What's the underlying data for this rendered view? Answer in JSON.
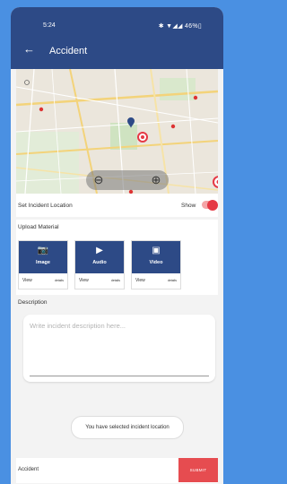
{
  "status": {
    "time": "5:24",
    "icons_text": "✱ ▼◢◢ 46%▯",
    "battery": "46%"
  },
  "appbar": {
    "back_icon": "←",
    "title": "Accident"
  },
  "map": {
    "zoom_out_symbol": "⊖",
    "zoom_in_symbol": "⊕"
  },
  "location": {
    "label": "Set Incident Location",
    "show_label": "Show",
    "show_enabled": true
  },
  "upload": {
    "title": "Upload Material",
    "tiles": [
      {
        "icon": "camera-icon",
        "glyph": "📷",
        "name": "Image",
        "view": "View",
        "detail": "details"
      },
      {
        "icon": "play-icon",
        "glyph": "▶",
        "name": "Audio",
        "view": "View",
        "detail": "details"
      },
      {
        "icon": "video-icon",
        "glyph": "▣",
        "name": "Video",
        "view": "View",
        "detail": "details"
      }
    ]
  },
  "description": {
    "label": "Description",
    "placeholder": "Write incident description here..."
  },
  "toast": {
    "message": "You have selected incident location"
  },
  "bottom": {
    "label": "Accident",
    "submit": "SUBMIT"
  },
  "colors": {
    "primary": "#2d4a86",
    "accent": "#e53945",
    "submit": "#e64c50",
    "background": "#4a90e2"
  }
}
